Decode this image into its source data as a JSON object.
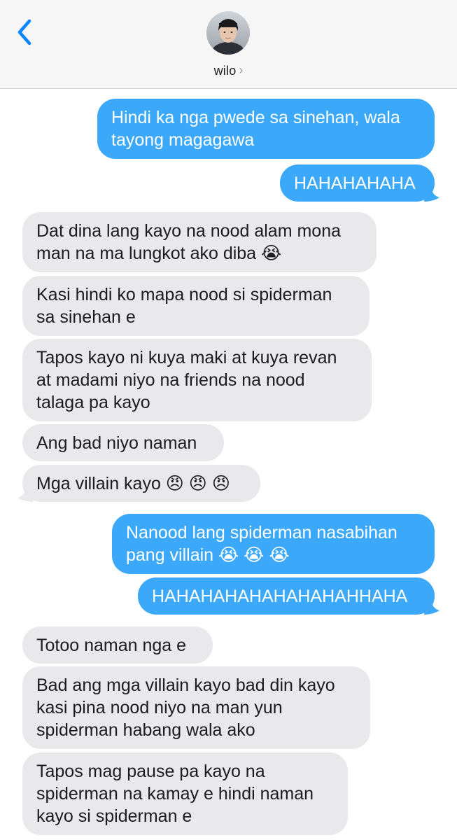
{
  "header": {
    "back_icon": "chevron-left-icon",
    "contact_name": "wilo",
    "contact_chevron": "›",
    "accent_color": "#0a84ff"
  },
  "colors": {
    "sent_bubble": "#3ca8f9",
    "received_bubble": "#e9e9eb",
    "header_bg": "#f6f6f6"
  },
  "messages": [
    {
      "from": "me",
      "lines": [
        "Hindi ka nga pwede sa sinehan, wala",
        "tayong magagawa"
      ]
    },
    {
      "from": "me",
      "lines": [
        "HAHAHAHAHA"
      ]
    },
    {
      "from": "wilo",
      "lines": [
        "Dat dina lang kayo na nood alam mona",
        "man na ma lungkot ako diba 😭"
      ]
    },
    {
      "from": "wilo",
      "lines": [
        "Kasi hindi ko mapa nood si spiderman",
        "sa sinehan e"
      ]
    },
    {
      "from": "wilo",
      "lines": [
        "Tapos kayo ni kuya maki at kuya revan",
        "at madami niyo na friends na nood",
        "talaga pa kayo"
      ]
    },
    {
      "from": "wilo",
      "lines": [
        "Ang bad niyo naman"
      ]
    },
    {
      "from": "wilo",
      "lines": [
        "Mga villain kayo 😠 😠 😠"
      ]
    },
    {
      "from": "me",
      "lines": [
        "Nanood lang spiderman nasabihan",
        "pang villain 😭 😭 😭"
      ]
    },
    {
      "from": "me",
      "lines": [
        "HAHAHAHAHAHAHAHAHHAHA"
      ]
    },
    {
      "from": "wilo",
      "lines": [
        "Totoo naman nga e"
      ]
    },
    {
      "from": "wilo",
      "lines": [
        "Bad ang mga villain kayo bad din kayo",
        "kasi pina nood niyo na man yun",
        "spiderman habang wala ako"
      ]
    },
    {
      "from": "wilo",
      "lines": [
        "Tapos mag pause pa kayo na",
        "spiderman na kamay e hindi naman",
        "kayo si spiderman e"
      ]
    }
  ]
}
